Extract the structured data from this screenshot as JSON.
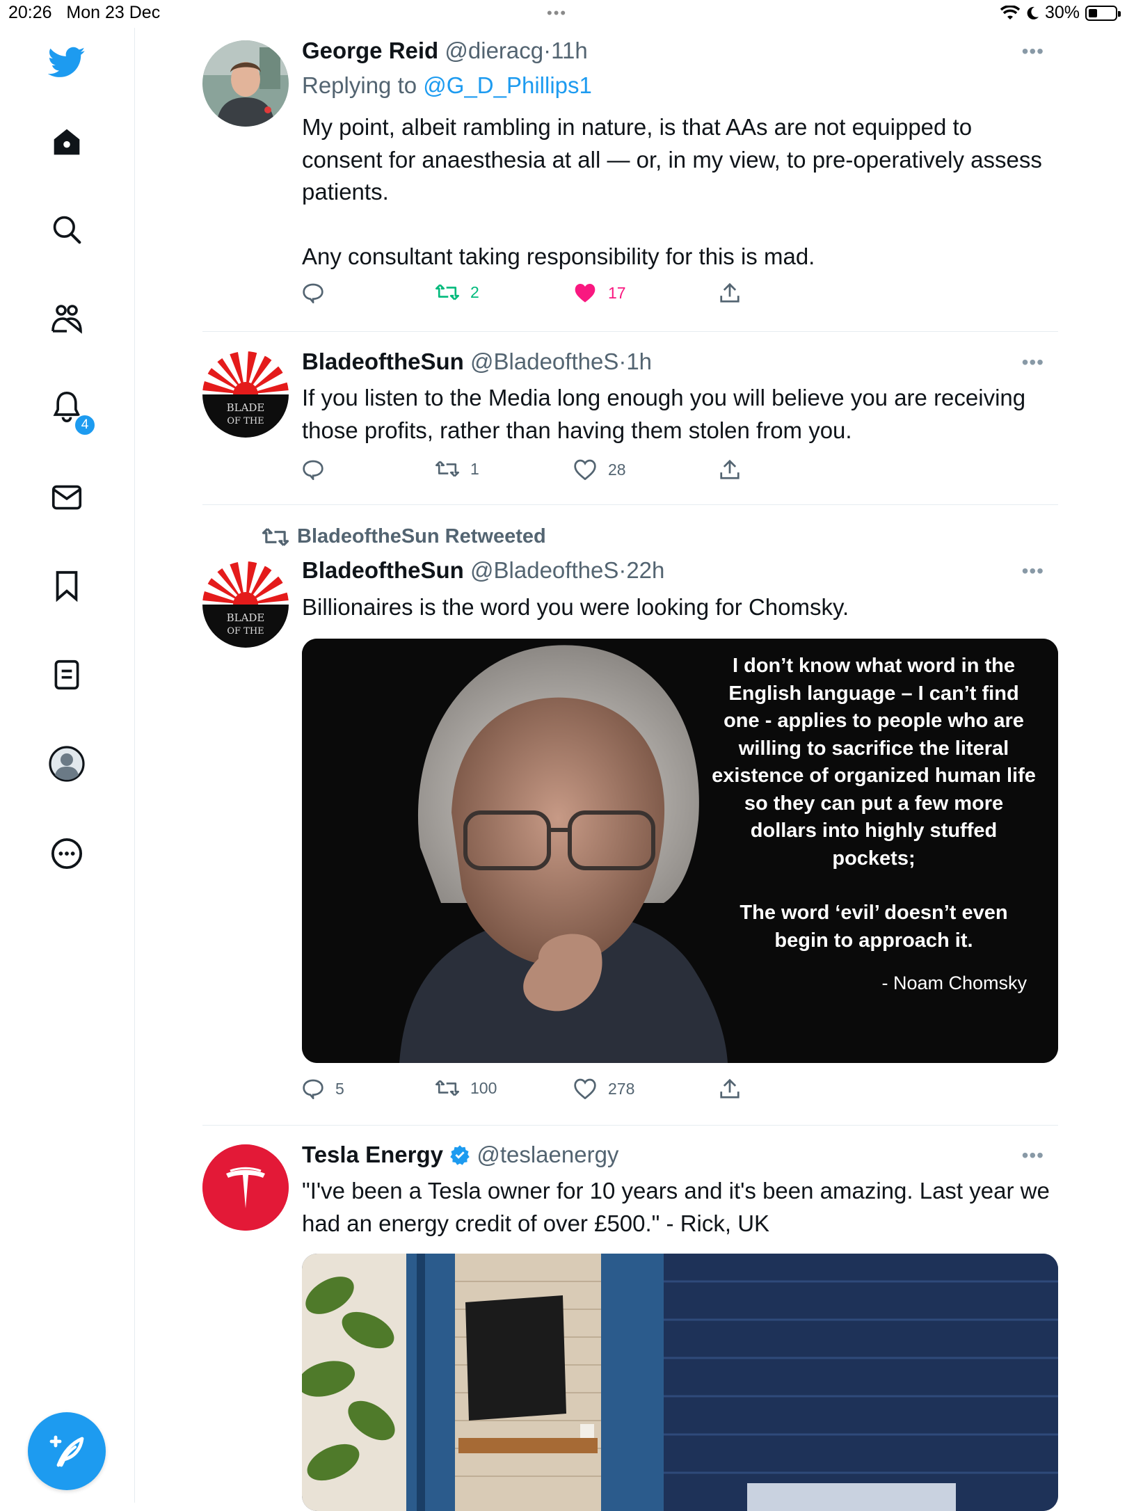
{
  "status_bar": {
    "time": "20:26",
    "date": "Mon 23 Dec",
    "battery": "30%"
  },
  "sidebar": {
    "items": [
      {
        "name": "home"
      },
      {
        "name": "explore"
      },
      {
        "name": "communities"
      },
      {
        "name": "notifications",
        "badge": "4"
      },
      {
        "name": "messages"
      },
      {
        "name": "bookmarks"
      },
      {
        "name": "lists"
      },
      {
        "name": "profile"
      },
      {
        "name": "more"
      }
    ],
    "notifications_badge": "4"
  },
  "tweets": [
    {
      "name": "George Reid",
      "handle": "@dieracg",
      "time": "11h",
      "replying_prefix": "Replying to",
      "replying_to": "@G_D_Phillips1",
      "text_p1": "My point, albeit rambling in nature, is that AAs are not equipped to consent for anaesthesia at all — or, in my view, to pre-operatively assess patients.",
      "text_p2": "Any consultant taking responsibility for this is mad.",
      "replies": "",
      "retweets": "2",
      "likes": "17"
    },
    {
      "name": "BladeoftheSun",
      "handle": "@BladeoftheS",
      "time": "1h",
      "text": "If you listen to the Media long enough you will believe you are receiving those profits, rather than having them stolen from you.",
      "replies": "",
      "retweets": "1",
      "likes": "28"
    },
    {
      "retweeted_by": "BladeoftheSun Retweeted",
      "name": "BladeoftheSun",
      "handle": "@BladeoftheS",
      "time": "22h",
      "text": "Billionaires is the word you were looking for Chomsky.",
      "image_quote": "I don’t know what word in the English language – I can’t find one - applies to people who are willing to sacrifice the literal existence of organized human life so they can put a few more dollars into highly stuffed pockets;",
      "image_quote2": "The word ‘evil’ doesn’t even begin to approach it.",
      "image_author": "- Noam Chomsky",
      "replies": "5",
      "retweets": "100",
      "likes": "278"
    },
    {
      "name": "Tesla Energy",
      "handle": "@teslaenergy",
      "verified": true,
      "text": "\"I've been a Tesla owner for 10 years and it's been amazing. Last year we had an energy credit of over £500.\" - Rick, UK"
    }
  ],
  "avatar_text": {
    "blade_line1": "BLADE",
    "blade_line2": "OF THE"
  },
  "colors": {
    "accent": "#1d9bf0",
    "like": "#f91880",
    "retweet": "#00ba7c",
    "tesla": "#e31937"
  }
}
